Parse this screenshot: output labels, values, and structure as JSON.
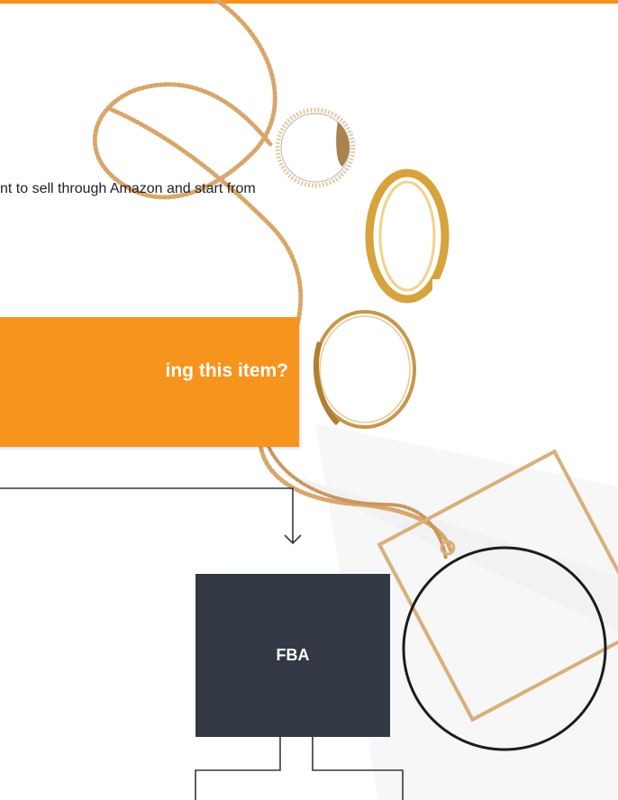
{
  "header": {
    "accent_color": "#f7941d"
  },
  "intro": {
    "text": "nt to sell through Amazon and start from"
  },
  "question": {
    "text": "ing this item?",
    "box_color": "#f7941d"
  },
  "flow": {
    "node_label": "FBA",
    "node_color": "#333845"
  }
}
